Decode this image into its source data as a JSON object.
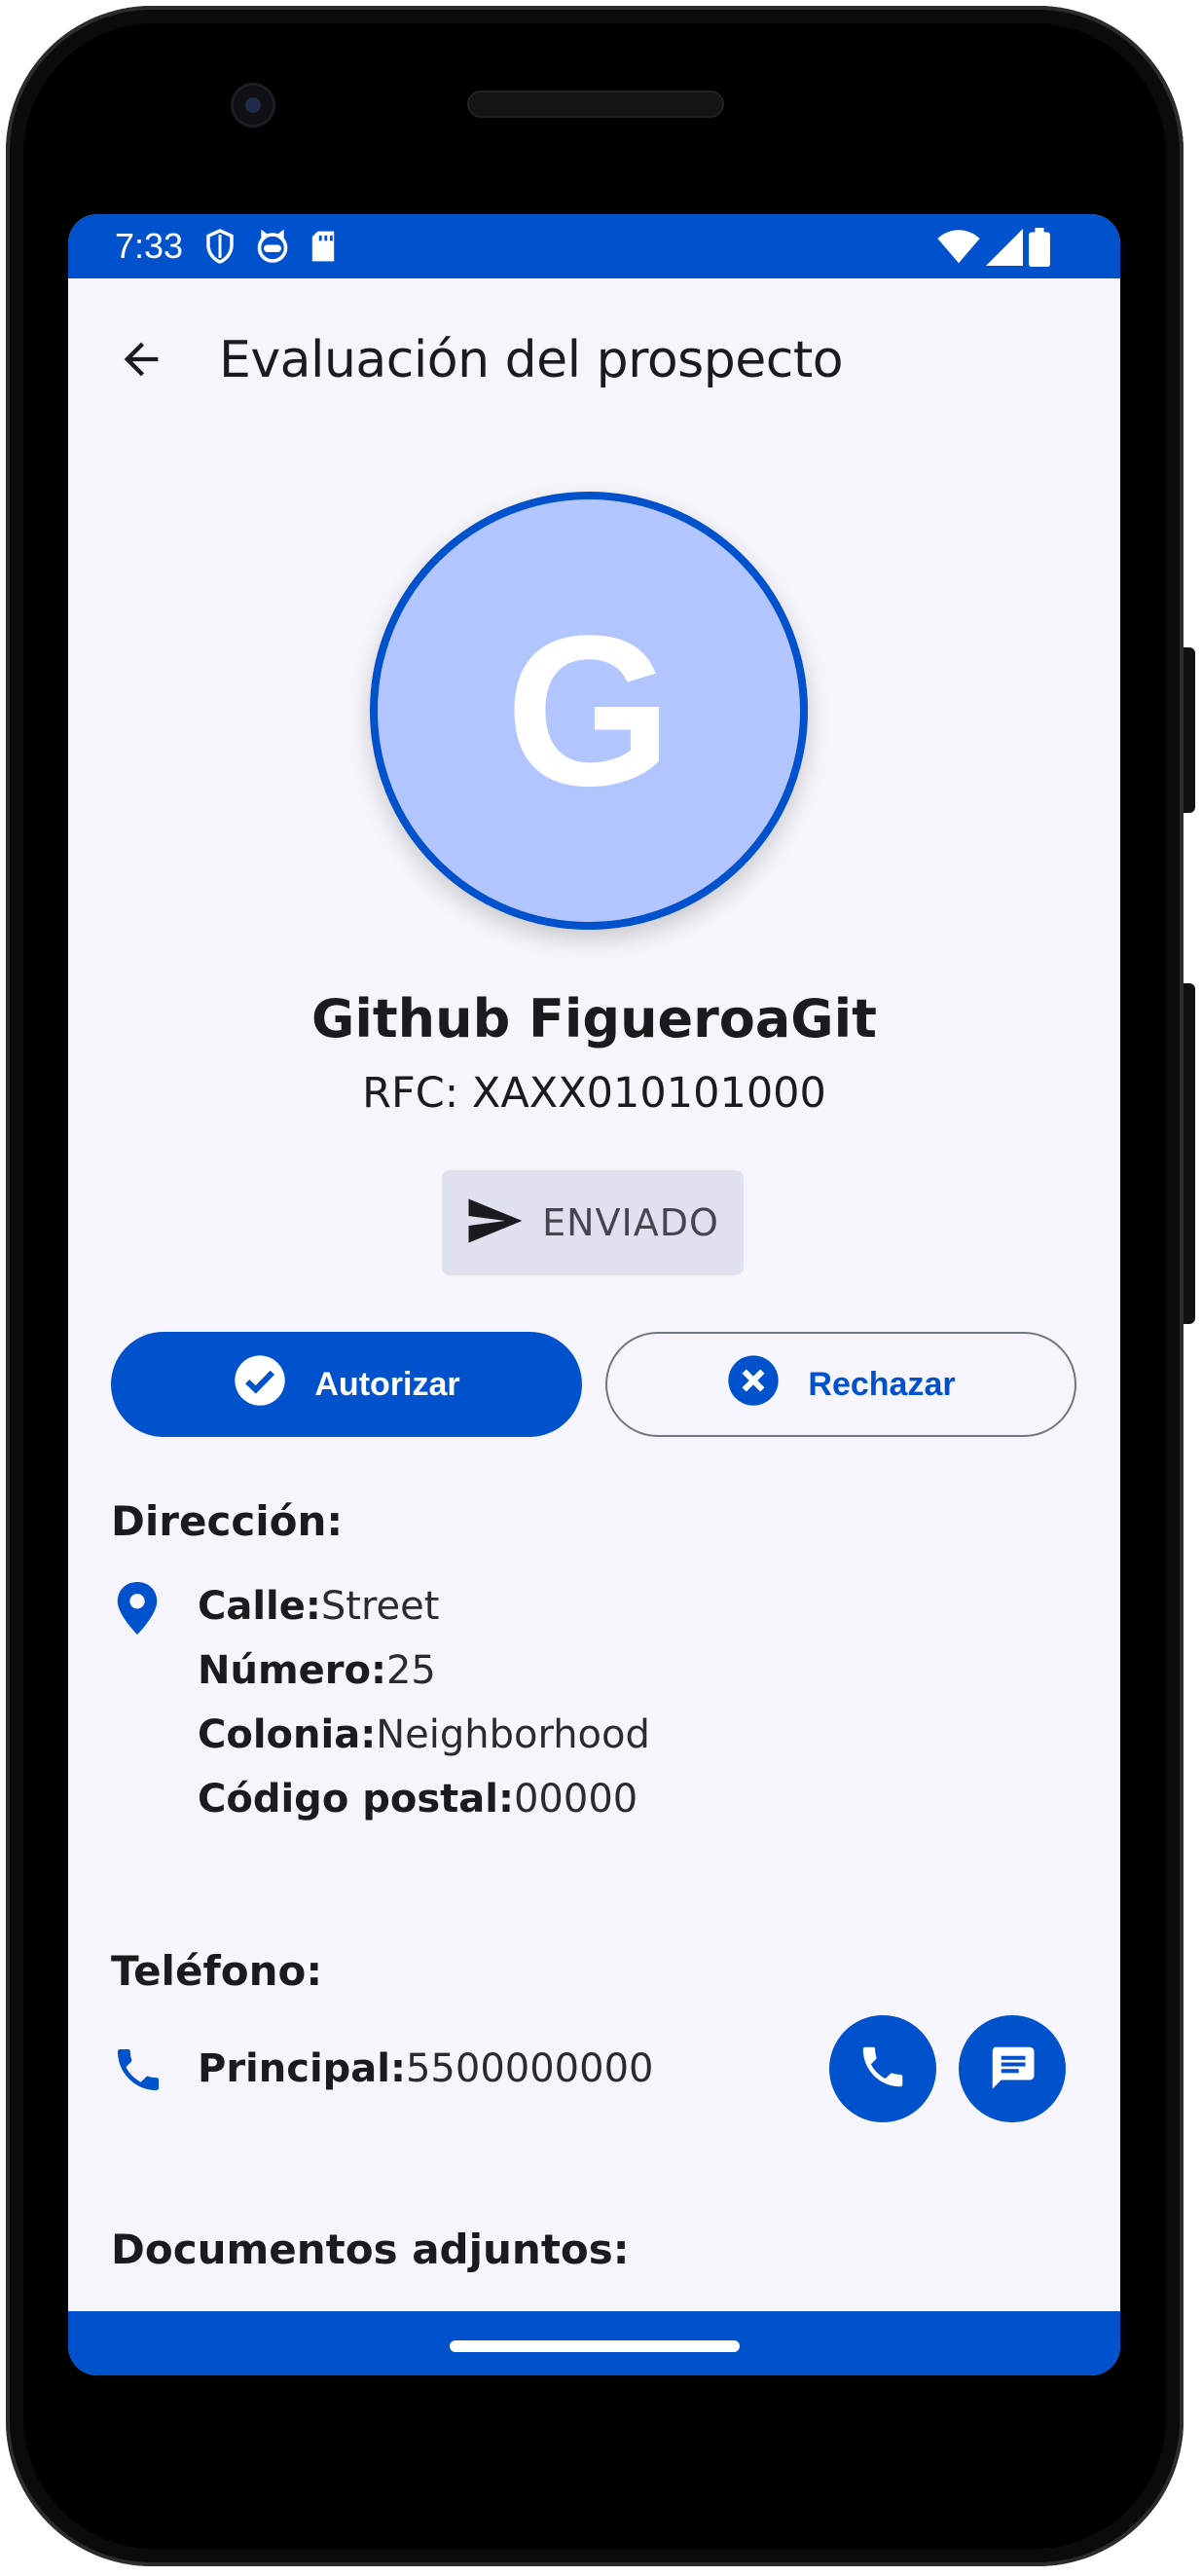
{
  "status_bar": {
    "time": "7:33",
    "left_icons": [
      "shield-icon",
      "cat-icon",
      "sd-card-icon"
    ],
    "right_icons": [
      "wifi-icon",
      "signal-icon",
      "battery-icon"
    ]
  },
  "app_bar": {
    "title": "Evaluación del prospecto",
    "back_icon": "arrow-back-icon"
  },
  "profile": {
    "avatar_letter": "G",
    "name": "Github FigueroaGit",
    "rfc": "RFC: XAXX010101000"
  },
  "status_chip": {
    "icon": "send-icon",
    "label": "ENVIADO"
  },
  "actions": {
    "authorize_label": "Autorizar",
    "reject_label": "Rechazar"
  },
  "address": {
    "title": "Dirección:",
    "street_label": "Calle:",
    "street_value": "Street",
    "number_label": "Número:",
    "number_value": "25",
    "neighborhood_label": "Colonia:",
    "neighborhood_value": "Neighborhood",
    "postal_label": "Código postal:",
    "postal_value": "00000"
  },
  "phone": {
    "title": "Teléfono:",
    "main_label": "Principal:",
    "main_value": "5500000000"
  },
  "documents": {
    "title": "Documentos adjuntos:"
  },
  "colors": {
    "primary": "#0052cc",
    "avatar_bg": "#b2c5ff",
    "screen_bg": "#f6f5fb",
    "chip_bg": "#dfe1ee"
  }
}
